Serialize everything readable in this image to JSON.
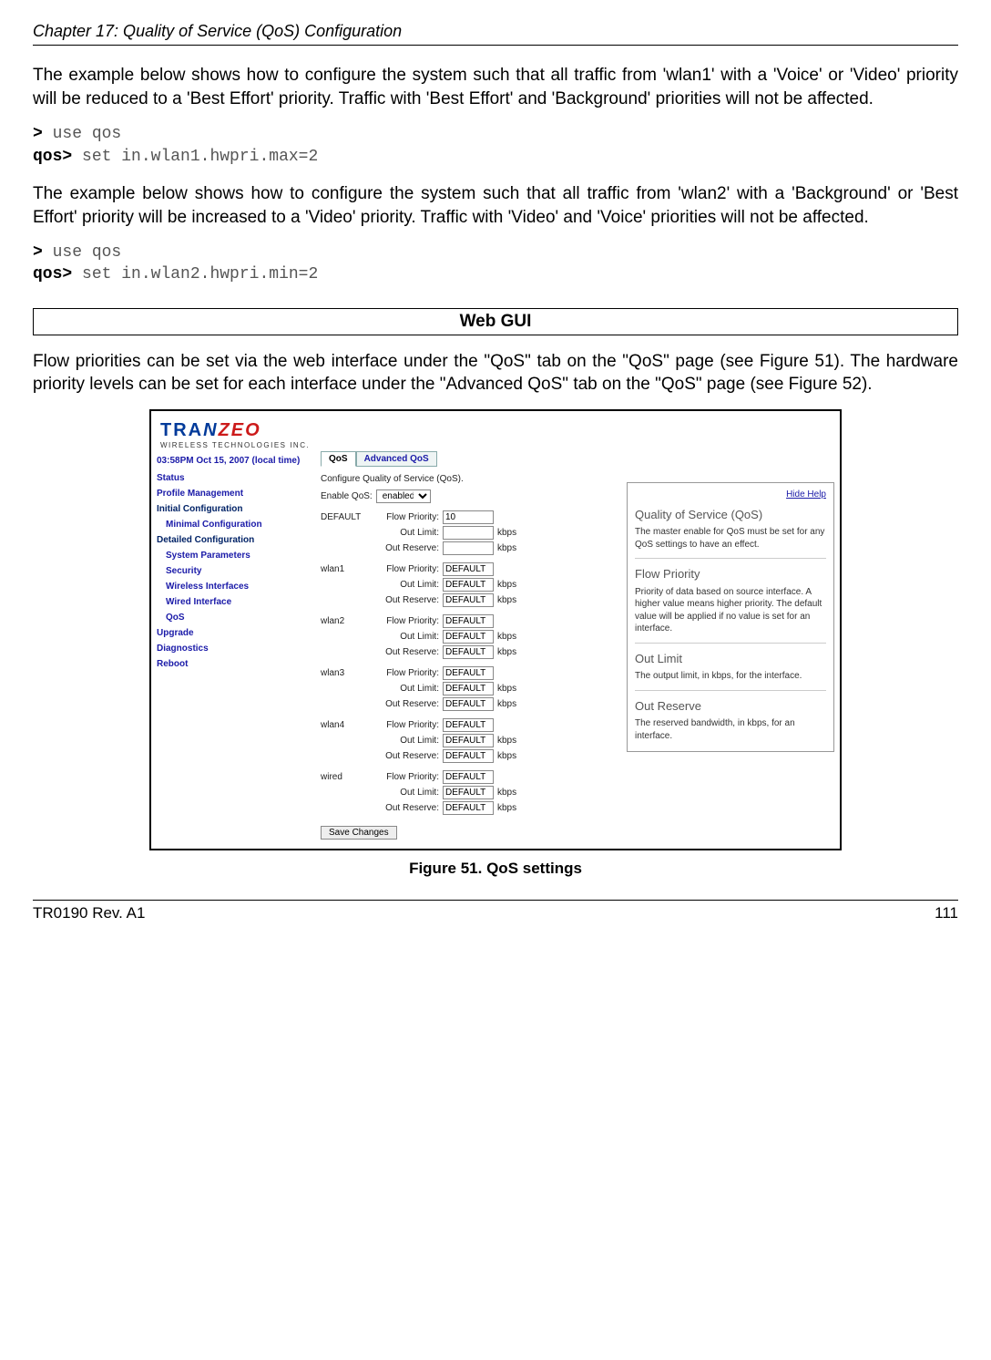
{
  "header": {
    "chapter": "Chapter 17: Quality of Service (QoS) Configuration"
  },
  "p1": "The example below shows how to configure the system such that all traffic from 'wlan1' with a 'Voice' or 'Video' priority will be reduced to a 'Best Effort' priority. Traffic with 'Best Effort' and 'Background' priorities will not be affected.",
  "code1": {
    "prompt1": ">",
    "cmd1": "use qos",
    "prompt2": "qos>",
    "cmd2": "set in.wlan1.hwpri.max=2"
  },
  "p2": "The example below shows how to configure the system such that all traffic from 'wlan2' with a 'Background' or 'Best Effort' priority will be increased to a 'Video' priority. Traffic with 'Video' and 'Voice' priorities will not be affected.",
  "code2": {
    "prompt1": ">",
    "cmd1": "use qos",
    "prompt2": "qos>",
    "cmd2": "set in.wlan2.hwpri.min=2"
  },
  "section": "Web GUI",
  "p3": "Flow priorities can be set via the web interface under the \"QoS\" tab on the \"QoS\" page (see Figure 51). The hardware priority levels can be set for each interface under the \"Advanced QoS\" tab on the \"QoS\" page (see Figure 52).",
  "figure": {
    "logo": {
      "t": "TRA",
      "n": "N",
      "z": "ZEO",
      "sub": "WIRELESS  TECHNOLOGIES INC."
    },
    "timestamp": "03:58PM Oct 15, 2007 (local time)",
    "nav": {
      "status": "Status",
      "profile": "Profile Management",
      "initial": "Initial Configuration",
      "minimal": "Minimal Configuration",
      "detailed": "Detailed Configuration",
      "sysparam": "System Parameters",
      "security": "Security",
      "wifaces": "Wireless Interfaces",
      "wired": "Wired Interface",
      "qos": "QoS",
      "upgrade": "Upgrade",
      "diag": "Diagnostics",
      "reboot": "Reboot"
    },
    "tabs": {
      "qos": "QoS",
      "adv": "Advanced QoS"
    },
    "desc": "Configure Quality of Service (QoS).",
    "enable_label": "Enable QoS:",
    "enable_value": "enabled",
    "labels": {
      "flow": "Flow Priority:",
      "outlimit": "Out Limit:",
      "outreserve": "Out Reserve:",
      "kbps": "kbps"
    },
    "default_name": "DEFAULT",
    "default_flow": "10",
    "ifaces": [
      {
        "name": "wlan1",
        "flow": "DEFAULT",
        "limit": "DEFAULT",
        "reserve": "DEFAULT"
      },
      {
        "name": "wlan2",
        "flow": "DEFAULT",
        "limit": "DEFAULT",
        "reserve": "DEFAULT"
      },
      {
        "name": "wlan3",
        "flow": "DEFAULT",
        "limit": "DEFAULT",
        "reserve": "DEFAULT"
      },
      {
        "name": "wlan4",
        "flow": "DEFAULT",
        "limit": "DEFAULT",
        "reserve": "DEFAULT"
      },
      {
        "name": "wired",
        "flow": "DEFAULT",
        "limit": "DEFAULT",
        "reserve": "DEFAULT"
      }
    ],
    "save": "Save Changes",
    "help": {
      "hide": "Hide Help",
      "h1": "Quality of Service (QoS)",
      "t1": "The master enable for QoS must be set for any QoS settings to have an effect.",
      "h2": "Flow Priority",
      "t2": "Priority of data based on source interface. A higher value means higher priority. The default value will be applied if no value is set for an interface.",
      "h3": "Out Limit",
      "t3": "The output limit, in kbps, for the interface.",
      "h4": "Out Reserve",
      "t4": "The reserved bandwidth, in kbps, for an interface."
    },
    "caption": "Figure 51. QoS settings"
  },
  "footer": {
    "left": "TR0190 Rev. A1",
    "right": "111"
  }
}
